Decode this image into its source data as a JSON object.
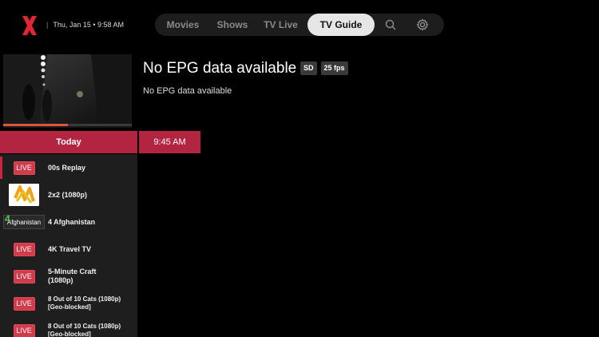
{
  "header": {
    "datetime": "Thu, Jan 15 • 9:58 AM",
    "nav": [
      {
        "label": "Movies"
      },
      {
        "label": "Shows"
      },
      {
        "label": "TV Live"
      },
      {
        "label": "TV Guide"
      }
    ],
    "active_nav": "TV Guide",
    "icons": [
      "search-icon",
      "gear-icon"
    ],
    "brand_color": "#e02636"
  },
  "preview": {
    "progress_percent": 50
  },
  "program": {
    "title": "No EPG data available",
    "badges": [
      "SD",
      "25 fps"
    ],
    "description": "No EPG data available"
  },
  "timeline": {
    "day_label": "Today",
    "time_slot": "9:45 AM",
    "accent": "#b2243f"
  },
  "channels": [
    {
      "name": "00s Replay",
      "logo": "LIVE"
    },
    {
      "name": "2x2 (1080p)",
      "logo": "2x2-logo"
    },
    {
      "name": "4 Afghanistan",
      "logo_number": "4",
      "logo_text": "Afghanistan"
    },
    {
      "name": "4K Travel TV",
      "logo": "LIVE"
    },
    {
      "name": "5-Minute Craft (1080p)",
      "logo": "LIVE"
    },
    {
      "name": "8 Out of 10 Cats (1080p) [Geo-blocked]",
      "logo": "LIVE"
    },
    {
      "name": "8 Out of 10 Cats (1080p) [Geo-blocked]",
      "logo": "LIVE"
    }
  ]
}
